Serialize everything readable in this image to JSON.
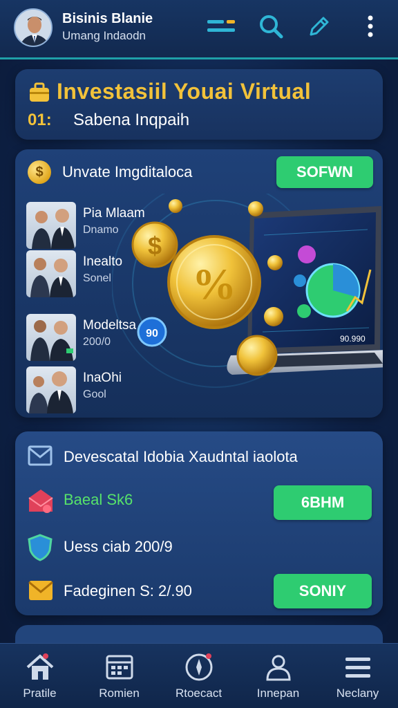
{
  "header": {
    "user_name": "Bisinis Blanie",
    "user_sub": "Umang Indaodn"
  },
  "title_panel": {
    "title": "Investasiil Youai Virtual",
    "subtitle_prefix": "01:",
    "subtitle": "Sabena Inqpaih"
  },
  "main_card": {
    "title": "Unvate Imgditaloca",
    "button_label": "SOFWN",
    "coin_symbol": "$",
    "people": [
      {
        "name": "Pia Mlaam",
        "sub": "Dnamo"
      },
      {
        "name": "Inealto",
        "sub": "Sonel"
      },
      {
        "name": "Modeltsa",
        "sub": "200/0"
      },
      {
        "name": "InaOhi",
        "sub": "Gool"
      }
    ],
    "illustration": {
      "coin_badge": "90",
      "screen_value": "90.990"
    }
  },
  "deposit_card": {
    "title": "Devescatal Idobia Xaudntal iaolota",
    "rows": [
      {
        "text": "Baeal Sk6",
        "button": "6BHM"
      },
      {
        "text": "Uess ciab 200/9"
      },
      {
        "text": "Fadeginen S: 2/.90",
        "button": "SONIY"
      }
    ]
  },
  "bottom_nav": [
    {
      "label": "Pratile",
      "icon": "home-icon"
    },
    {
      "label": "Romien",
      "icon": "calendar-icon"
    },
    {
      "label": "Rtoecact",
      "icon": "compass-icon"
    },
    {
      "label": "Innepan",
      "icon": "user-icon"
    },
    {
      "label": "Neclany",
      "icon": "menu-icon"
    }
  ],
  "colors": {
    "accent_gold": "#f2c23a",
    "button_green": "#2ecc71",
    "positive_green": "#57e36a",
    "background_navy": "#0e2248"
  }
}
